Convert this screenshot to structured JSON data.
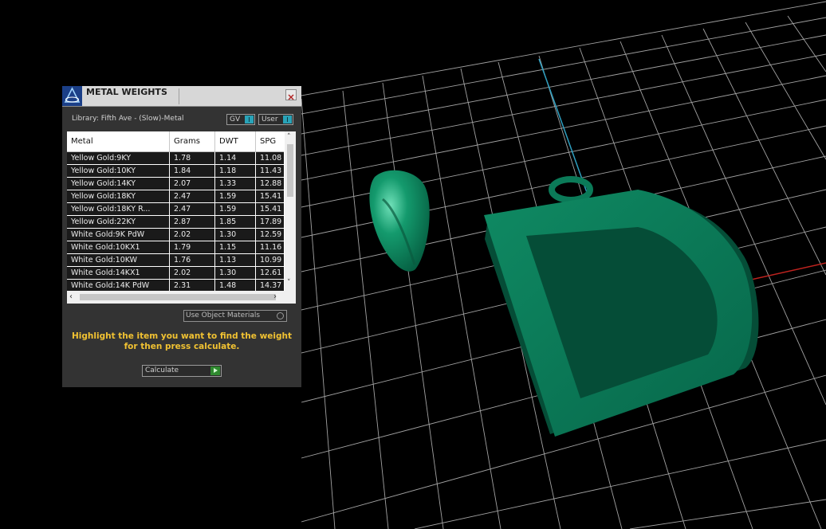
{
  "dialog": {
    "title": "METAL WEIGHTS",
    "close_icon": "close-icon",
    "logo_icon": "app-logo-icon",
    "library_label": "Library: Fifth Ave - (Slow)-Metal",
    "toggle_gv": "GV",
    "toggle_user": "User",
    "use_object_materials": "Use Object Materials",
    "instructions_line1": "Highlight the item you want to find the weight",
    "instructions_line2": "for then press calculate.",
    "calculate": "Calculate",
    "accent_color": "#29a3b8",
    "instructions_color": "#f1c232"
  },
  "table": {
    "columns": [
      "Metal",
      "Grams",
      "DWT",
      "SPG"
    ],
    "rows": [
      [
        "Yellow Gold:9KY",
        "1.78",
        "1.14",
        "11.08"
      ],
      [
        "Yellow Gold:10KY",
        "1.84",
        "1.18",
        "11.43"
      ],
      [
        "Yellow Gold:14KY",
        "2.07",
        "1.33",
        "12.88"
      ],
      [
        "Yellow Gold:18KY",
        "2.47",
        "1.59",
        "15.41"
      ],
      [
        "Yellow Gold:18KY R...",
        "2.47",
        "1.59",
        "15.41"
      ],
      [
        "Yellow Gold:22KY",
        "2.87",
        "1.85",
        "17.89"
      ],
      [
        "White Gold:9K PdW",
        "2.02",
        "1.30",
        "12.59"
      ],
      [
        "White Gold:10KX1",
        "1.79",
        "1.15",
        "11.16"
      ],
      [
        "White Gold:10KW",
        "1.76",
        "1.13",
        "10.99"
      ],
      [
        "White Gold:14KX1",
        "2.02",
        "1.30",
        "12.61"
      ],
      [
        "White Gold:14K PdW",
        "2.31",
        "1.48",
        "14.37"
      ]
    ]
  },
  "scene": {
    "model_color": "#0b7a58",
    "grid_color": "#cfcfcf",
    "axis_x_color": "#c0231f",
    "axis_y_color": "#2e9fc0"
  }
}
